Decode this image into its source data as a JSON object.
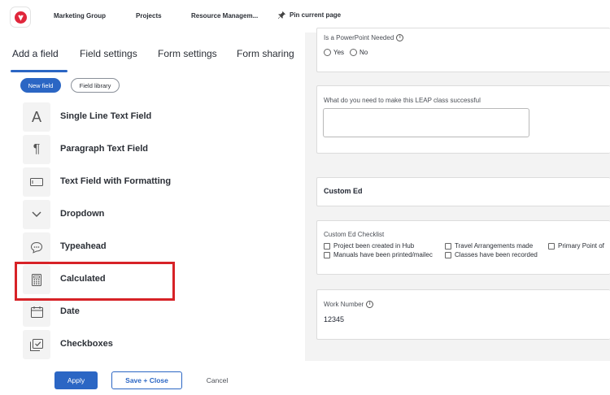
{
  "topbar": {
    "nav": [
      "Marketing Group",
      "Projects",
      "Resource Managem..."
    ],
    "pin_label": "Pin current page"
  },
  "left": {
    "tabs": [
      "Add a field",
      "Field settings",
      "Form settings",
      "Form sharing"
    ],
    "chips": {
      "new_field": "New field",
      "field_library": "Field library"
    },
    "fields": [
      {
        "label": "Single Line Text Field",
        "icon": "text-a-icon"
      },
      {
        "label": "Paragraph Text Field",
        "icon": "paragraph-icon"
      },
      {
        "label": "Text Field with Formatting",
        "icon": "rich-text-icon"
      },
      {
        "label": "Dropdown",
        "icon": "chevron-down-icon"
      },
      {
        "label": "Typeahead",
        "icon": "speech-bubble-icon"
      },
      {
        "label": "Calculated",
        "icon": "calculator-icon"
      },
      {
        "label": "Date",
        "icon": "calendar-icon"
      },
      {
        "label": "Checkboxes",
        "icon": "checkbox-icon"
      }
    ]
  },
  "form": {
    "powerpoint": {
      "label": "Is a PowerPoint Needed",
      "options": [
        "Yes",
        "No"
      ]
    },
    "leap": {
      "label": "What do you need to make this LEAP class successful",
      "value": ""
    },
    "section": {
      "title": "Custom Ed"
    },
    "checklist": {
      "label": "Custom Ed Checklist",
      "options": [
        "Project been created in Hub",
        "Travel Arrangements made",
        "Primary Point of",
        "Manuals have been printed/mailec",
        "Classes have been recorded"
      ]
    },
    "work_number": {
      "label": "Work Number",
      "value": "12345"
    }
  },
  "footer": {
    "apply": "Apply",
    "save_close": "Save + Close",
    "cancel": "Cancel"
  },
  "colors": {
    "accent": "#2b66c4",
    "highlight": "#d72227",
    "logo": "#e0263b"
  }
}
